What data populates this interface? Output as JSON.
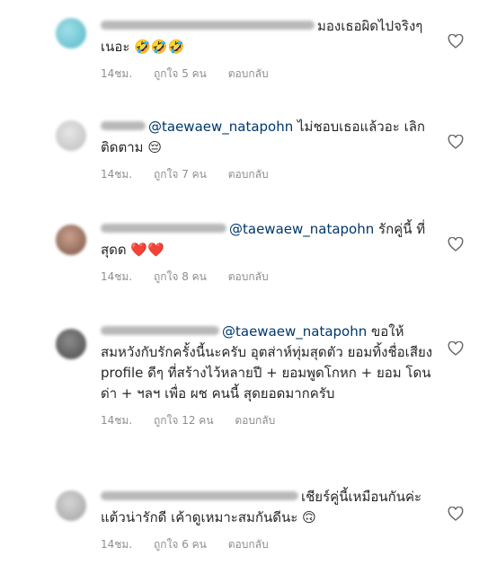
{
  "comments": [
    {
      "text": "มองเธอผิดไปจริงๆเนอะ",
      "emojis": "🤣🤣🤣",
      "mention": "",
      "time": "14ชม.",
      "likes": "ถูกใจ 5 คน",
      "reply": "ตอบกลับ"
    },
    {
      "mention": "@taewaew_natapohn",
      "text": " ไม่ชอบเธอแล้วอะ เลิกติดตาม",
      "emojis": "😔",
      "time": "14ชม.",
      "likes": "ถูกใจ 7 คน",
      "reply": "ตอบกลับ"
    },
    {
      "mention": "@taewaew_natapohn",
      "text": " รักคู่นี้ ที่สุดด",
      "emojis": "❤️❤️",
      "time": "14ชม.",
      "likes": "ถูกใจ 8 คน",
      "reply": "ตอบกลับ"
    },
    {
      "mention": "@taewaew_natapohn",
      "text": " ขอให้สมหวังกับรักครั้งนี้นะครับ อุตส่าห์ทุ่มสุดตัว ยอมทิ้งชื่อเสียง profile ดีๆ ที่สร้างไว้หลายปี + ยอมพูดโกหก + ยอม โดนด่า + ฯลฯ เพื่อ ผช คนนี้ สุดยอดมากครับ",
      "emojis": "",
      "time": "14ชม.",
      "likes": "ถูกใจ 12 คน",
      "reply": "ตอบกลับ"
    },
    {
      "mention": "",
      "text": "เชียร์คู่นี้เหมือนกันค่ะ แต้วน่ารักดี เค้าดูเหมาะสมกันดีนะ",
      "emojis": "🙃",
      "time": "14ชม.",
      "likes": "ถูกใจ 6 คน",
      "reply": "ตอบกลับ"
    }
  ],
  "icons": {
    "like": "heart-outline-icon",
    "avatar": "blurred-avatar"
  },
  "colors": {
    "mention": "#00376b",
    "meta": "#8e8e8e",
    "text": "#262626"
  }
}
